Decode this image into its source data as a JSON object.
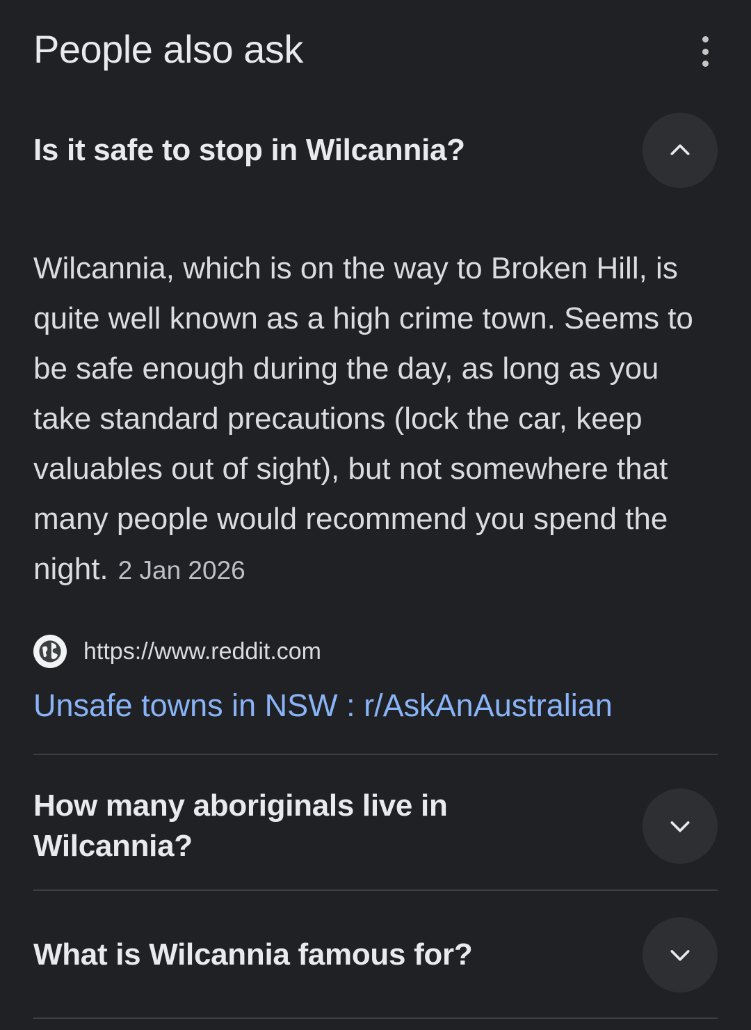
{
  "header": {
    "title": "People also ask"
  },
  "questions": [
    {
      "text": "Is it safe to stop in Wilcannia?",
      "expanded": true,
      "answer": "Wilcannia, which is on the way to Broken Hill, is quite well known as a high crime town. Seems to be safe enough during the day, as long as you take standard precautions (lock the car, keep valuables out of sight), but not somewhere that many people would recommend you spend the night.",
      "date": "2 Jan 2026",
      "source_url": "https://www.reddit.com",
      "link_title": "Unsafe towns in NSW : r/AskAnAustralian"
    },
    {
      "text": "How many aboriginals live in Wilcannia?",
      "expanded": false
    },
    {
      "text": "What is Wilcannia famous for?",
      "expanded": false
    }
  ],
  "icons": {
    "more": "more-vert-icon",
    "collapse": "chevron-up-icon",
    "expand": "chevron-down-icon",
    "source": "globe-icon"
  },
  "colors": {
    "background": "#202124",
    "link": "#8ab4f8",
    "button": "#2d2f33"
  }
}
